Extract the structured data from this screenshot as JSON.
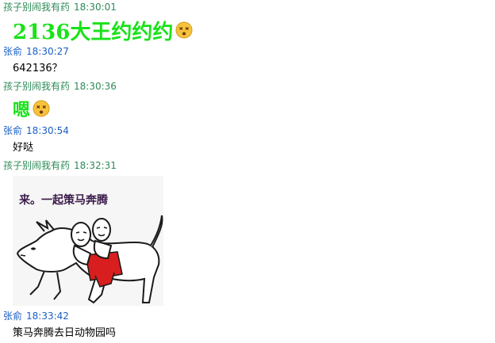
{
  "messages": [
    {
      "sender": "孩子别闹我有药",
      "time": "18:30:01",
      "text": "2136大王约约约",
      "style": "big",
      "emoji": "dizzy-face-icon"
    },
    {
      "sender": "张俞",
      "time": "18:30:27",
      "text": "642136？",
      "style": "plain"
    },
    {
      "sender": "孩子别闹我有药",
      "time": "18:30:36",
      "text": "嗯",
      "style": "big",
      "emoji": "dizzy-face-icon"
    },
    {
      "sender": "张俞",
      "time": "18:30:54",
      "text": "好哒",
      "style": "plain"
    },
    {
      "sender": "孩子别闹我有药",
      "time": "18:32:31",
      "style": "sticker",
      "sticker_caption": "来。一起策马奔腾"
    },
    {
      "sender": "张俞",
      "time": "18:33:42",
      "text": "策马奔腾去日动物园吗",
      "style": "plain"
    }
  ],
  "colors": {
    "sender_other": "#2e8b57",
    "sender_self": "#1a5fc4",
    "big_text": "#19e219"
  }
}
